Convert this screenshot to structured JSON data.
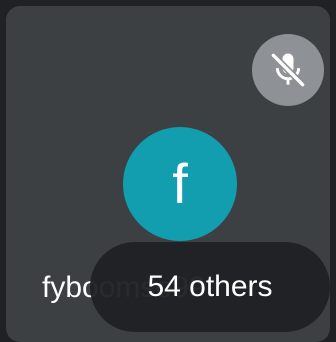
{
  "tile": {
    "participant_name": "fyboomso99",
    "avatar_initial": "f",
    "avatar_color": "#129eaf",
    "mic_icon": "mic-off-icon",
    "mic_muted": true
  },
  "others_pill": {
    "label": "54 others"
  }
}
